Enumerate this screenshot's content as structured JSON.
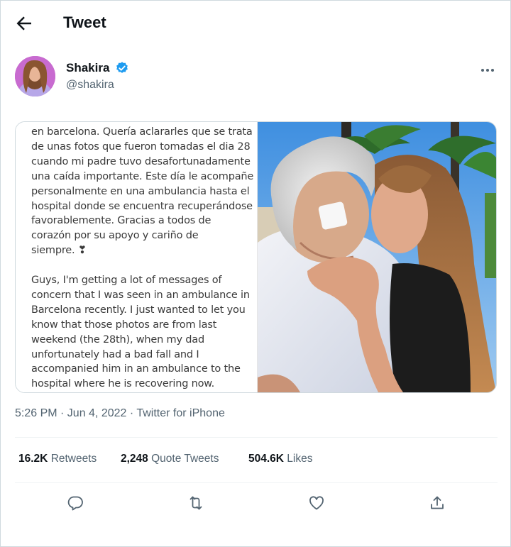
{
  "header": {
    "title": "Tweet"
  },
  "author": {
    "name": "Shakira",
    "handle": "@shakira"
  },
  "media_text": {
    "paragraph_1": "en barcelona. Quería aclararles que se trata\nde unas fotos que fueron tomadas el dia 28\ncuando mi padre tuvo desafortunadamente\nuna caída importante. Este día le acompañe\npersonalmente en una ambulancia hasta el\nhospital donde se encuentra recuperándose\nfavorablemente. Gracias a todos de\ncorazón por su apoyo y cariño de\nsiempre. ❣",
    "paragraph_2": "Guys, I'm getting a lot of messages of\nconcern that I was seen in an ambulance in\nBarcelona recently. I just wanted to let you\nknow that those photos are from last\nweekend (the 28th), when my dad\nunfortunately had a bad fall and I\naccompanied him in an ambulance to the\nhospital where he is recovering now."
  },
  "timestamp": "5:26 PM · Jun 4, 2022 · Twitter for iPhone",
  "stats": {
    "retweets_count": "16.2K",
    "retweets_label": "Retweets",
    "quotes_count": "2,248",
    "quotes_label": "Quote Tweets",
    "likes_count": "504.6K",
    "likes_label": "Likes"
  },
  "colors": {
    "brand_blue": "#1d9bf0",
    "text": "#0f1419",
    "secondary": "#536471"
  },
  "icons": [
    "back-arrow-icon",
    "verified-badge-icon",
    "more-icon",
    "reply-icon",
    "retweet-icon",
    "like-icon",
    "share-icon"
  ]
}
